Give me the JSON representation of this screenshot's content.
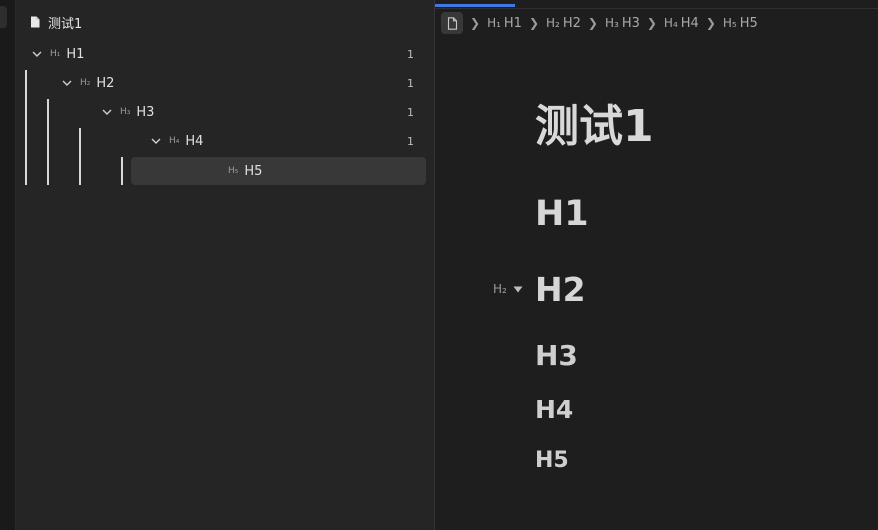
{
  "outline": {
    "file_name": "测试1",
    "items": [
      {
        "level": "H₁",
        "label": "H1",
        "count": "1"
      },
      {
        "level": "H₂",
        "label": "H2",
        "count": "1"
      },
      {
        "level": "H₃",
        "label": "H3",
        "count": "1"
      },
      {
        "level": "H₄",
        "label": "H4",
        "count": "1"
      },
      {
        "level": "H₅",
        "label": "H5",
        "count": ""
      }
    ]
  },
  "breadcrumb": [
    {
      "level": "H₁",
      "label": "H1"
    },
    {
      "level": "H₂",
      "label": "H2"
    },
    {
      "level": "H₃",
      "label": "H3"
    },
    {
      "level": "H₄",
      "label": "H4"
    },
    {
      "level": "H₅",
      "label": "H5"
    }
  ],
  "document": {
    "title": "测试1",
    "h1": "H1",
    "h2": "H2",
    "h3": "H3",
    "h4": "H4",
    "h5": "H5",
    "gutter_badge": "H₂"
  },
  "colors": {
    "accent": "#3d78e3",
    "background": "#1e1e1e",
    "panel": "#252525"
  }
}
